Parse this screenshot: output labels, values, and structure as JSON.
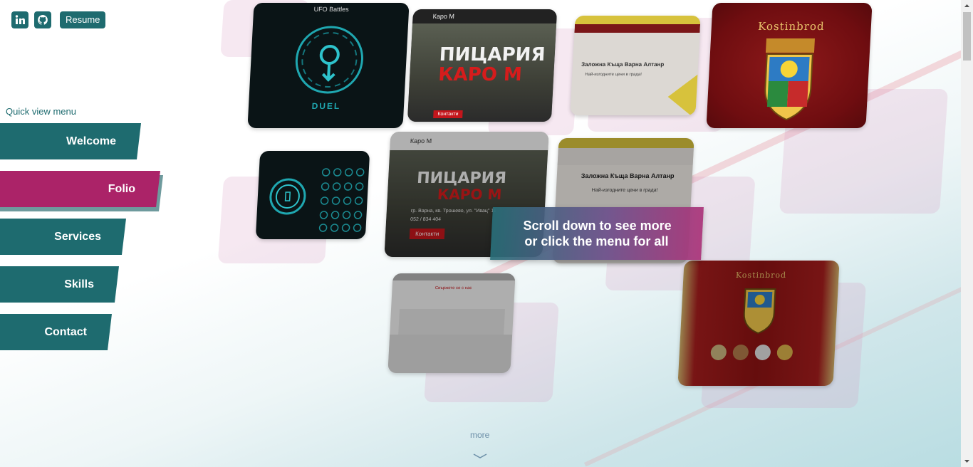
{
  "social": {
    "linkedin_icon": "linkedin-icon",
    "github_icon": "github-icon",
    "resume_label": "Resume"
  },
  "quick_menu": {
    "title": "Quick view menu",
    "items": [
      {
        "label": "Welcome",
        "active": false
      },
      {
        "label": "Folio",
        "active": true
      },
      {
        "label": "Services",
        "active": false
      },
      {
        "label": "Skills",
        "active": false
      },
      {
        "label": "Contact",
        "active": false
      }
    ]
  },
  "portfolio": {
    "cards": {
      "ufo": "UFO Battles",
      "duel": "DUEL",
      "pizza_brand": "Каро М",
      "pizza_title_line1": "ПИЦАРИЯ",
      "pizza_title_line2": "КАРО М",
      "pizza_address": "гр. Варна, кв. Трошево, ул. \"Ивац\" 11",
      "pizza_phone": "052 / 834 404",
      "pizza_contacts": "Контакти",
      "pawn_title": "Заложна Къща Варна Алтанр",
      "pawn_subtitle": "Най-изгодните цени в града!",
      "kostin_title": "Kostinbrod",
      "map_heading": "Свържете се с нас"
    },
    "overlay_line1": "Scroll down to see more",
    "overlay_line2": "or click the menu for all",
    "more_label": "more"
  },
  "colors": {
    "teal": "#1e6b6f",
    "magenta": "#ab2368"
  }
}
